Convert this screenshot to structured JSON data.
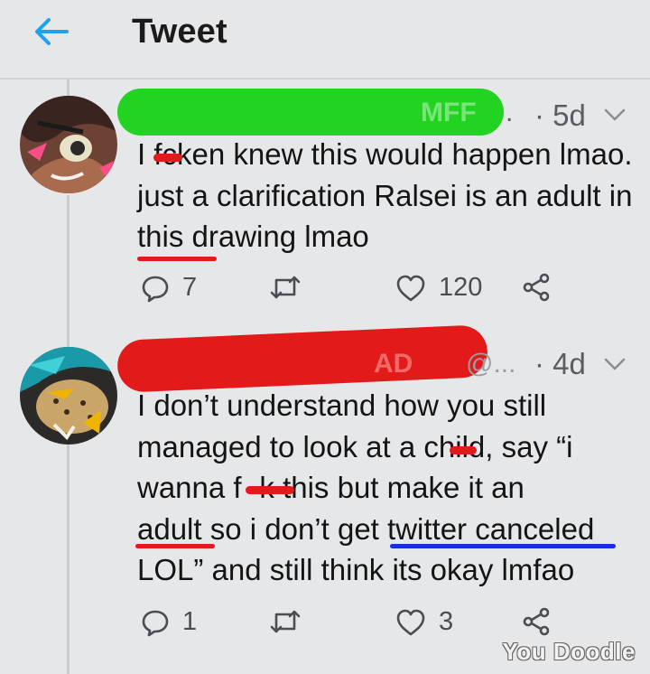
{
  "header": {
    "title": "Tweet",
    "back_icon": "arrow-left-icon",
    "accent_color": "#1da1f2"
  },
  "tweets": [
    {
      "handle_redacted_tail": "MFF",
      "handle_suffix": ".",
      "time": "· 5d",
      "text": "I f__cken knew this would happen lmao. just a clarification Ralsei is an adult in this drawing lmao",
      "text_prefix": "I f",
      "text_rest": "cken knew this would happen lmao. just a clarification Ralsei is an adult in this drawing lmao",
      "replies": "7",
      "likes": "120",
      "redaction_color": "#22d322"
    },
    {
      "handle_redacted_tail": "AD",
      "handle_suffix": "@...",
      "time": "· 4d",
      "text": "I don't understand how you still managed to look at a ch__ld, say “i wanna f__k this but make it an adult so i don't get twitter canceled LOL” and still think its okay lmfao",
      "line1": "I don’t understand how you still",
      "line2": "managed to look at a child, say “i",
      "line3": "wanna f   k this but make it an",
      "line4_a": "adult",
      "line4_b": " so i don’t get ",
      "line4_c": "twitter canceled",
      "line5": "LOL” and still think its okay lmfao",
      "replies": "1",
      "likes": "3",
      "redaction_color": "#e31a1a"
    }
  ],
  "annotations": {
    "underline_red": "#e31a1a",
    "underline_blue": "#1530e0"
  },
  "icons": [
    "reply-icon",
    "retweet-icon",
    "like-icon",
    "share-icon",
    "chevron-down-icon"
  ],
  "watermark": "You Doodle"
}
